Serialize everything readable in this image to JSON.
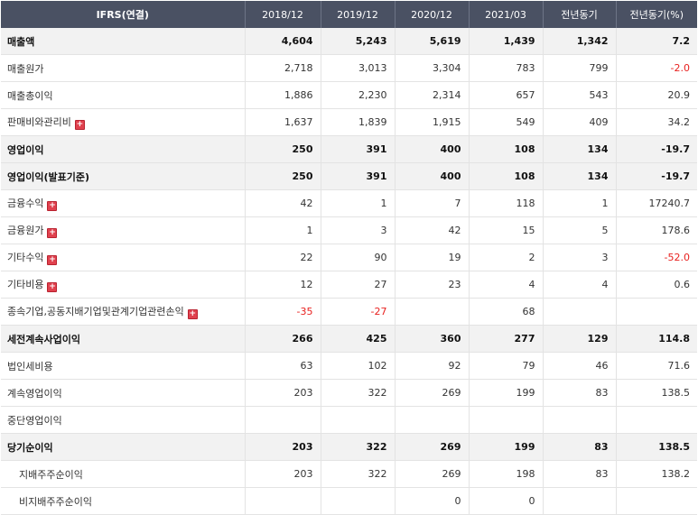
{
  "header": [
    "IFRS(연결)",
    "2018/12",
    "2019/12",
    "2020/12",
    "2021/03",
    "전년동기",
    "전년동기(%)"
  ],
  "colors": {
    "header_bg": "#4a5163",
    "bold_row_bg": "#f2f2f2",
    "negative": "#e8211f",
    "expand_icon": "#e0414e"
  },
  "rows": [
    {
      "label": "매출액",
      "bold": true,
      "expandable": false,
      "indent": false,
      "values": [
        "4,604",
        "5,243",
        "5,619",
        "1,439",
        "1,342",
        "7.2"
      ],
      "neg": [
        false,
        false,
        false,
        false,
        false,
        false
      ]
    },
    {
      "label": "매출원가",
      "bold": false,
      "expandable": false,
      "indent": false,
      "values": [
        "2,718",
        "3,013",
        "3,304",
        "783",
        "799",
        "-2.0"
      ],
      "neg": [
        false,
        false,
        false,
        false,
        false,
        true
      ]
    },
    {
      "label": "매출총이익",
      "bold": false,
      "expandable": false,
      "indent": false,
      "values": [
        "1,886",
        "2,230",
        "2,314",
        "657",
        "543",
        "20.9"
      ],
      "neg": [
        false,
        false,
        false,
        false,
        false,
        false
      ]
    },
    {
      "label": "판매비와관리비",
      "bold": false,
      "expandable": true,
      "indent": false,
      "values": [
        "1,637",
        "1,839",
        "1,915",
        "549",
        "409",
        "34.2"
      ],
      "neg": [
        false,
        false,
        false,
        false,
        false,
        false
      ]
    },
    {
      "label": "영업이익",
      "bold": true,
      "expandable": false,
      "indent": false,
      "values": [
        "250",
        "391",
        "400",
        "108",
        "134",
        "-19.7"
      ],
      "neg": [
        false,
        false,
        false,
        false,
        false,
        true
      ]
    },
    {
      "label": "영업이익(발표기준)",
      "bold": true,
      "expandable": false,
      "indent": false,
      "values": [
        "250",
        "391",
        "400",
        "108",
        "134",
        "-19.7"
      ],
      "neg": [
        false,
        false,
        false,
        false,
        false,
        true
      ]
    },
    {
      "label": "금융수익",
      "bold": false,
      "expandable": true,
      "indent": false,
      "values": [
        "42",
        "1",
        "7",
        "118",
        "1",
        "17240.7"
      ],
      "neg": [
        false,
        false,
        false,
        false,
        false,
        false
      ]
    },
    {
      "label": "금융원가",
      "bold": false,
      "expandable": true,
      "indent": false,
      "values": [
        "1",
        "3",
        "42",
        "15",
        "5",
        "178.6"
      ],
      "neg": [
        false,
        false,
        false,
        false,
        false,
        false
      ]
    },
    {
      "label": "기타수익",
      "bold": false,
      "expandable": true,
      "indent": false,
      "values": [
        "22",
        "90",
        "19",
        "2",
        "3",
        "-52.0"
      ],
      "neg": [
        false,
        false,
        false,
        false,
        false,
        true
      ]
    },
    {
      "label": "기타비용",
      "bold": false,
      "expandable": true,
      "indent": false,
      "values": [
        "12",
        "27",
        "23",
        "4",
        "4",
        "0.6"
      ],
      "neg": [
        false,
        false,
        false,
        false,
        false,
        false
      ]
    },
    {
      "label": "종속기업,공동지배기업및관계기업관련손익",
      "bold": false,
      "expandable": true,
      "indent": false,
      "values": [
        "-35",
        "-27",
        "",
        "68",
        "",
        ""
      ],
      "neg": [
        true,
        true,
        false,
        false,
        false,
        false
      ]
    },
    {
      "label": "세전계속사업이익",
      "bold": true,
      "expandable": false,
      "indent": false,
      "values": [
        "266",
        "425",
        "360",
        "277",
        "129",
        "114.8"
      ],
      "neg": [
        false,
        false,
        false,
        false,
        false,
        false
      ]
    },
    {
      "label": "법인세비용",
      "bold": false,
      "expandable": false,
      "indent": false,
      "values": [
        "63",
        "102",
        "92",
        "79",
        "46",
        "71.6"
      ],
      "neg": [
        false,
        false,
        false,
        false,
        false,
        false
      ]
    },
    {
      "label": "계속영업이익",
      "bold": false,
      "expandable": false,
      "indent": false,
      "values": [
        "203",
        "322",
        "269",
        "199",
        "83",
        "138.5"
      ],
      "neg": [
        false,
        false,
        false,
        false,
        false,
        false
      ]
    },
    {
      "label": "중단영업이익",
      "bold": false,
      "expandable": false,
      "indent": false,
      "values": [
        "",
        "",
        "",
        "",
        "",
        ""
      ],
      "neg": [
        false,
        false,
        false,
        false,
        false,
        false
      ]
    },
    {
      "label": "당기순이익",
      "bold": true,
      "expandable": false,
      "indent": false,
      "values": [
        "203",
        "322",
        "269",
        "199",
        "83",
        "138.5"
      ],
      "neg": [
        false,
        false,
        false,
        false,
        false,
        false
      ]
    },
    {
      "label": "지배주주순이익",
      "bold": false,
      "expandable": false,
      "indent": true,
      "values": [
        "203",
        "322",
        "269",
        "198",
        "83",
        "138.2"
      ],
      "neg": [
        false,
        false,
        false,
        false,
        false,
        false
      ]
    },
    {
      "label": "비지배주주순이익",
      "bold": false,
      "expandable": false,
      "indent": true,
      "values": [
        "",
        "",
        "0",
        "0",
        "",
        ""
      ],
      "neg": [
        false,
        false,
        false,
        false,
        false,
        false
      ]
    }
  ]
}
